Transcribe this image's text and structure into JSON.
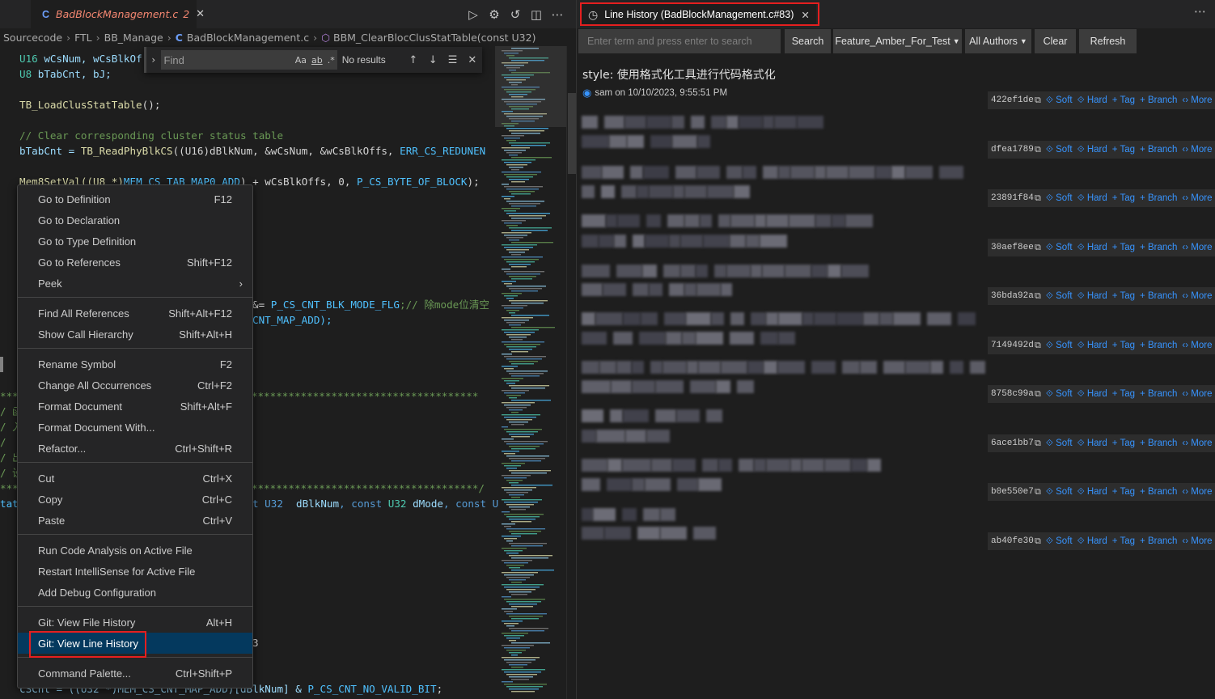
{
  "editor": {
    "tab": {
      "filename": "BadBlockManagement.c",
      "modified_count": "2"
    },
    "breadcrumb": [
      "Sourcecode",
      "FTL",
      "BB_Manage",
      "BadBlockManagement.c",
      "BBM_ClearBlocClusStatTable(const U32)"
    ],
    "find": {
      "placeholder": "Find",
      "status": "No results",
      "opt_case": "Aa",
      "opt_word": "ab",
      "opt_regex": ".*"
    }
  },
  "code": {
    "l1_type": "U16",
    "l1_rest": " wCsNum, wCsBlkOf",
    "l2_type": "U8",
    "l2_rest": " bTabCnt, bJ;",
    "l3_fn": "TB_LoadClusStatTable",
    "l3_rest": "();",
    "l4_cmt": "// Clear corresponding cluster status table",
    "l5_a": "bTabCnt = ",
    "l5_fn": "TB_ReadPhyBlkCS",
    "l5_b": "((U16)dBlkNum, &wCsNum, &wCsBlkOffs, ",
    "l5_mac": "ERR_CS_REDUNEN",
    "l6_a": "Mem8SetVal((U8 *)",
    "l6_mac": "MEM_CS_TAB_MAP0_ADD",
    "l6_b": ") + wCsBlkOffs, 0, ",
    "l6_mac2": "P_CS_BYTE_OF_BLOCK",
    "l6_c": ");",
    "l7_a": "&= ",
    "l7_mac": "P_CS_CNT_BLK_MODE_FLG",
    "l7_cmt": ";// 除mode位清空",
    "l8_a": "CNT_MAP_ADD);",
    "l9_stars": "******************************************************************************",
    "l10_a": "/ 函",
    "l11_a": "/ 入",
    "l12_a": "/",
    "l13_a": "/ 出",
    "l14_a": "/ 设",
    "l15_stars": "******************************************************************************/",
    "l16_a": "tat",
    "l16_b": "t U32 ",
    "l16_c": "dBlkNum",
    "l16_d": ", const ",
    "l16_e": "U32 ",
    "l16_f": "dMode",
    "l16_g": ", const U",
    "l17_a": "3",
    "l18_a": "cSCnt = ((U32 *)MEM_CS_CNT_MAP_ADD)[dBlkNum] & ",
    "l18_mac": "P_CS_CNT_NO_VALID_BIT",
    "l18_b": ";"
  },
  "context_menu": {
    "items": [
      {
        "label": "Go to Definition",
        "shortcut": "F12"
      },
      {
        "label": "Go to Declaration",
        "shortcut": ""
      },
      {
        "label": "Go to Type Definition",
        "shortcut": ""
      },
      {
        "label": "Go to References",
        "shortcut": "Shift+F12"
      },
      {
        "label": "Peek",
        "shortcut": ""
      },
      {
        "label": "Find All References",
        "shortcut": "Shift+Alt+F12"
      },
      {
        "label": "Show Call Hierarchy",
        "shortcut": "Shift+Alt+H"
      },
      {
        "label": "Rename Symbol",
        "shortcut": "F2"
      },
      {
        "label": "Change All Occurrences",
        "shortcut": "Ctrl+F2"
      },
      {
        "label": "Format Document",
        "shortcut": "Shift+Alt+F"
      },
      {
        "label": "Format Document With...",
        "shortcut": ""
      },
      {
        "label": "Refactor...",
        "shortcut": "Ctrl+Shift+R"
      },
      {
        "label": "Cut",
        "shortcut": "Ctrl+X"
      },
      {
        "label": "Copy",
        "shortcut": "Ctrl+C"
      },
      {
        "label": "Paste",
        "shortcut": "Ctrl+V"
      },
      {
        "label": "Run Code Analysis on Active File",
        "shortcut": ""
      },
      {
        "label": "Restart IntelliSense for Active File",
        "shortcut": ""
      },
      {
        "label": "Add Debug Configuration",
        "shortcut": ""
      },
      {
        "label": "Git: View File History",
        "shortcut": "Alt+H"
      },
      {
        "label": "Git: View Line History",
        "shortcut": ""
      },
      {
        "label": "Command Palette...",
        "shortcut": "Ctrl+Shift+P"
      }
    ]
  },
  "history_panel": {
    "tab_title": "Line History (BadBlockManagement.c#83)",
    "search_placeholder": "Enter term and press enter to search",
    "search_button": "Search",
    "branch_filter": "Feature_Amber_For_Test",
    "author_filter": "All Authors",
    "clear_button": "Clear",
    "refresh_button": "Refresh",
    "commit_title": "style: 使用格式化工具进行代码格式化",
    "commit_author": "sam",
    "commit_date": "on 10/10/2023, 9:55:51 PM",
    "actions": {
      "soft": "Soft",
      "hard": "Hard",
      "tag": "Tag",
      "branch": "Branch",
      "more": "More"
    },
    "commits": [
      {
        "hash": "422ef1de"
      },
      {
        "hash": "dfea1789"
      },
      {
        "hash": "23891f84"
      },
      {
        "hash": "30aef8ee"
      },
      {
        "hash": "36bda92a"
      },
      {
        "hash": "7149492d"
      },
      {
        "hash": "8758c99a"
      },
      {
        "hash": "6ace1bb7"
      },
      {
        "hash": "b0e550e7"
      },
      {
        "hash": "ab40fe30"
      }
    ]
  },
  "colors": {
    "accent": "#3794ff",
    "highlight_box": "#e51f1f",
    "menu_selected": "#04395e"
  },
  "icons": [
    "c-file-icon",
    "run-icon",
    "settings-icon",
    "history-icon",
    "split-editor-icon",
    "more-icon",
    "symbol-method-icon",
    "eye-icon",
    "copy-icon"
  ]
}
